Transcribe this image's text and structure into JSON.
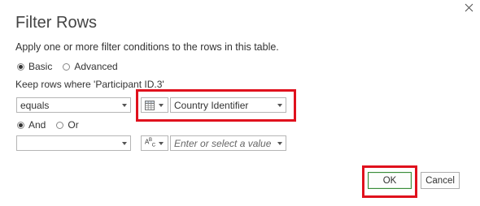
{
  "dialog": {
    "title": "Filter Rows",
    "subtitle": "Apply one or more filter conditions to the rows in this table."
  },
  "mode": {
    "basic_label": "Basic",
    "advanced_label": "Advanced",
    "selected": "Basic"
  },
  "keep_rows_label": "Keep rows where 'Participant ID.3'",
  "condition1": {
    "operator": "equals",
    "type_icon": "table-icon",
    "value": "Country Identifier"
  },
  "logic": {
    "and_label": "And",
    "or_label": "Or",
    "selected": "And"
  },
  "condition2": {
    "operator": "",
    "type_icon": "abc-text-icon",
    "type_text": "ABC",
    "value_placeholder": "Enter or select a value"
  },
  "buttons": {
    "ok": "OK",
    "cancel": "Cancel"
  },
  "colors": {
    "highlight": "#e0111d",
    "ok_border": "#3a8b3a"
  }
}
